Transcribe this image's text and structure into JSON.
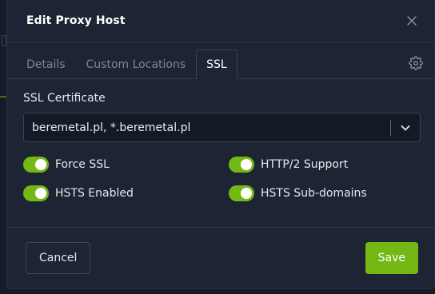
{
  "modal": {
    "title": "Edit Proxy Host"
  },
  "tabs": [
    {
      "label": "Details",
      "active": false
    },
    {
      "label": "Custom Locations",
      "active": false
    },
    {
      "label": "SSL",
      "active": true
    }
  ],
  "ssl": {
    "certificate_label": "SSL Certificate",
    "certificate_value": "beremetal.pl, *.beremetal.pl",
    "toggles": [
      {
        "label": "Force SSL",
        "enabled": true
      },
      {
        "label": "HTTP/2 Support",
        "enabled": true
      },
      {
        "label": "HSTS Enabled",
        "enabled": true
      },
      {
        "label": "HSTS Sub-domains",
        "enabled": true
      }
    ]
  },
  "footer": {
    "cancel_label": "Cancel",
    "save_label": "Save"
  },
  "colors": {
    "accent_green": "#74b816",
    "modal_bg": "#1d2433",
    "backdrop": "#151b27"
  },
  "icons": {
    "close": "close-icon",
    "settings": "gear-icon",
    "dropdown": "chevron-down-icon"
  }
}
